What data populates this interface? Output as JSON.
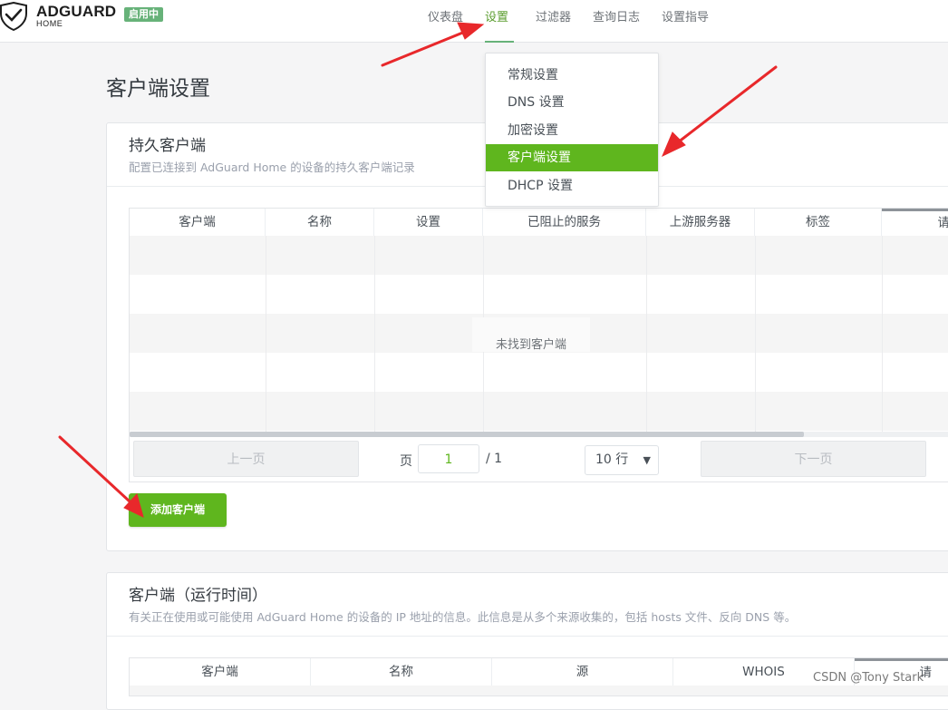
{
  "header": {
    "logo_text": "ADGUARD",
    "logo_sub": "HOME",
    "status_badge": "启用中",
    "nav": [
      "仪表盘",
      "设置",
      "过滤器",
      "查询日志",
      "设置指导"
    ]
  },
  "dropdown": {
    "items": [
      "常规设置",
      "DNS 设置",
      "加密设置",
      "客户端设置",
      "DHCP 设置"
    ],
    "active": "客户端设置"
  },
  "page_title": "客户端设置",
  "persistent": {
    "title": "持久客户端",
    "subtitle": "配置已连接到 AdGuard Home 的设备的持久客户端记录",
    "columns": [
      "客户端",
      "名称",
      "设置",
      "已阻止的服务",
      "上游服务器",
      "标签",
      "请"
    ],
    "empty_message": "未找到客户端",
    "prev_label": "上一页",
    "next_label": "下一页",
    "page_label": "页",
    "page_value": "1",
    "page_total": "/ 1",
    "rows_per_page": "10 行",
    "add_button": "添加客户端"
  },
  "runtime": {
    "title": "客户端（运行时间）",
    "subtitle": "有关正在使用或可能使用 AdGuard Home 的设备的 IP 地址的信息。此信息是从多个来源收集的，包括 hosts 文件、反向 DNS 等。",
    "columns": [
      "客户端",
      "名称",
      "源",
      "WHOIS",
      "请"
    ]
  },
  "watermark": "CSDN @Tony Stark",
  "colors": {
    "accent": "#5fb61e",
    "annotation": "#e8282b",
    "badge": "#67b279"
  }
}
